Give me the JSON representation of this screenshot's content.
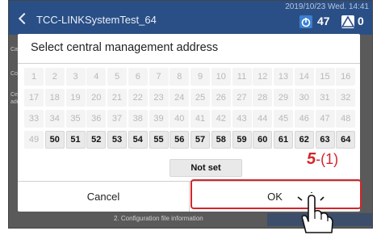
{
  "header": {
    "title": "TCC-LINKSystemTest_64",
    "datetime": "2019/10/23 Wed. 14:41",
    "alarm_count": "47",
    "warning_count": "0",
    "alarm_color": "#2f7fd4",
    "warning_color": "#3b8fe0"
  },
  "background": {
    "side_labels": [
      "Cance",
      "Conn",
      "Centr",
      "addre"
    ],
    "footer_text": "2. Configuration file information"
  },
  "dialog": {
    "title": "Select central management address",
    "rows": [
      [
        "1",
        "2",
        "3",
        "4",
        "5",
        "6",
        "7",
        "8",
        "9",
        "10",
        "11",
        "12",
        "13",
        "14",
        "15",
        "16"
      ],
      [
        "17",
        "18",
        "19",
        "20",
        "21",
        "22",
        "23",
        "24",
        "25",
        "26",
        "27",
        "28",
        "29",
        "30",
        "31",
        "32"
      ],
      [
        "33",
        "34",
        "35",
        "36",
        "37",
        "38",
        "39",
        "40",
        "41",
        "42",
        "43",
        "44",
        "45",
        "46",
        "47",
        "48"
      ],
      [
        "49",
        "50",
        "51",
        "52",
        "53",
        "54",
        "55",
        "56",
        "57",
        "58",
        "59",
        "60",
        "61",
        "62",
        "63",
        "64"
      ]
    ],
    "first_enabled": 50,
    "not_set_label": "Not set",
    "cancel_label": "Cancel",
    "ok_label": "OK"
  },
  "callout": {
    "step_number": "5",
    "step_suffix": "-(1)",
    "color": "#d4252a"
  }
}
